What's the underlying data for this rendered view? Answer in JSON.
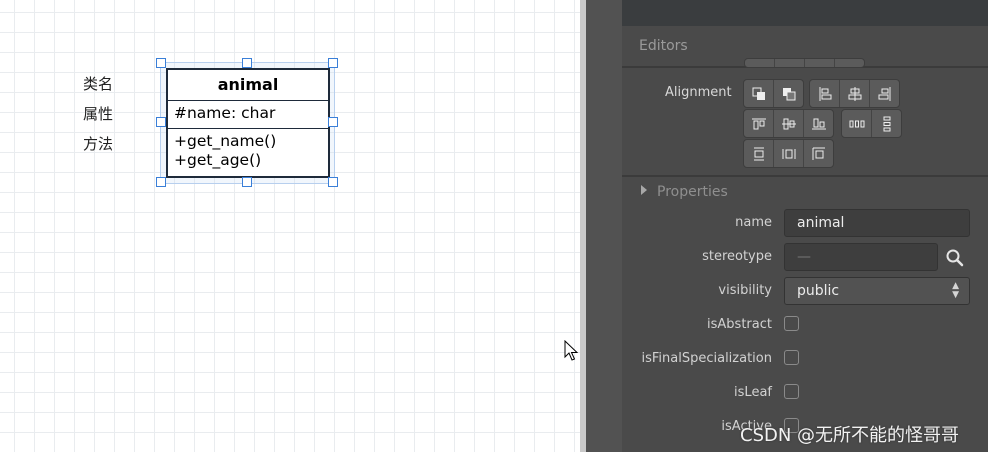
{
  "canvas": {
    "side_labels": [
      "类名",
      "属性",
      "方法"
    ],
    "uml_class": {
      "name": "animal",
      "attributes": [
        "#name: char"
      ],
      "operations": [
        "+get_name()",
        "+get_age()"
      ]
    }
  },
  "panel": {
    "editors_title": "Editors",
    "alignment_label": "Alignment",
    "properties_title": "Properties",
    "properties": {
      "name_label": "name",
      "name_value": "animal",
      "stereotype_label": "stereotype",
      "stereotype_placeholder": "—",
      "visibility_label": "visibility",
      "visibility_value": "public",
      "isAbstract_label": "isAbstract",
      "isFinalSpecialization_label": "isFinalSpecialization",
      "isLeaf_label": "isLeaf",
      "isActive_label": "isActive"
    },
    "icons": {
      "alignment_buttons": [
        "bring-to-front-icon",
        "send-to-back-icon",
        "align-left-icon",
        "align-center-icon",
        "align-right-icon",
        "align-top-icon",
        "align-middle-icon",
        "align-bottom-icon",
        "space-equally-horizontal-icon",
        "space-equally-vertical-icon",
        "set-width-equally-icon",
        "set-height-equally-icon",
        "set-size-equally-icon"
      ],
      "search": "search-icon",
      "select": "select-arrows-icon"
    }
  },
  "watermark": "CSDN @无所不能的怪哥哥"
}
